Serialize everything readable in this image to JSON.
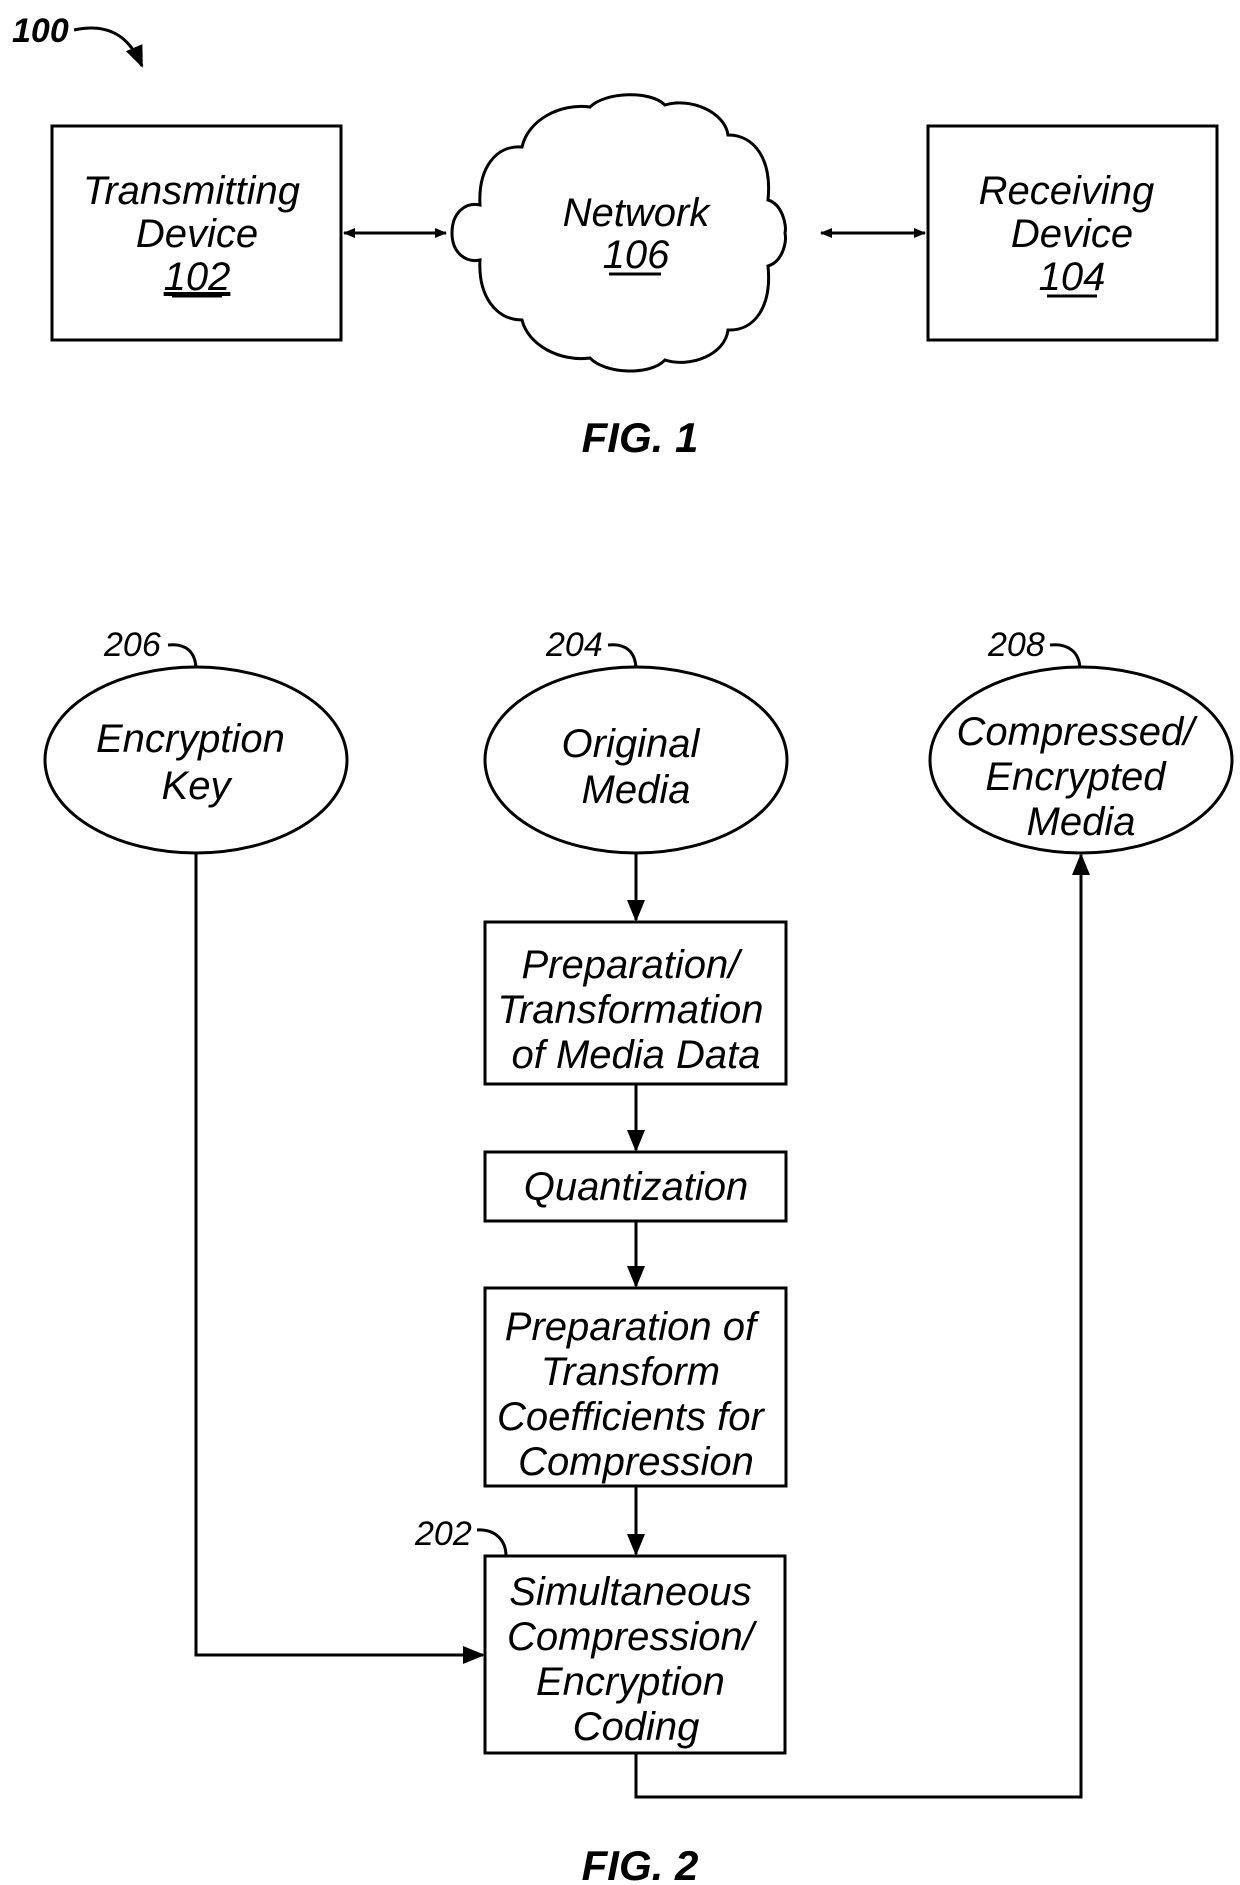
{
  "fig1": {
    "ref_label": "100",
    "caption": "FIG. 1",
    "transmitting": {
      "lines": [
        "Transmitting",
        "Device"
      ],
      "ref": "102"
    },
    "network": {
      "lines": [
        "Network"
      ],
      "ref": "106"
    },
    "receiving": {
      "lines": [
        "Receiving",
        "Device"
      ],
      "ref": "104"
    }
  },
  "fig2": {
    "caption": "FIG. 2",
    "encryption_key": {
      "lines": [
        "Encryption",
        "Key"
      ],
      "ref": "206"
    },
    "original_media": {
      "lines": [
        "Original",
        "Media"
      ],
      "ref": "204"
    },
    "compressed_media": {
      "lines": [
        "Compressed/",
        "Encrypted",
        "Media"
      ],
      "ref": "208"
    },
    "steps": [
      {
        "lines": [
          "Preparation/",
          "Transformation",
          "of Media Data"
        ]
      },
      {
        "lines": [
          "Quantization"
        ]
      },
      {
        "lines": [
          "Preparation of",
          "Transform",
          "Coefficients for",
          "Compression"
        ]
      },
      {
        "lines": [
          "Simultaneous",
          "Compression/",
          "Encryption",
          "Coding"
        ],
        "ref": "202"
      }
    ]
  }
}
